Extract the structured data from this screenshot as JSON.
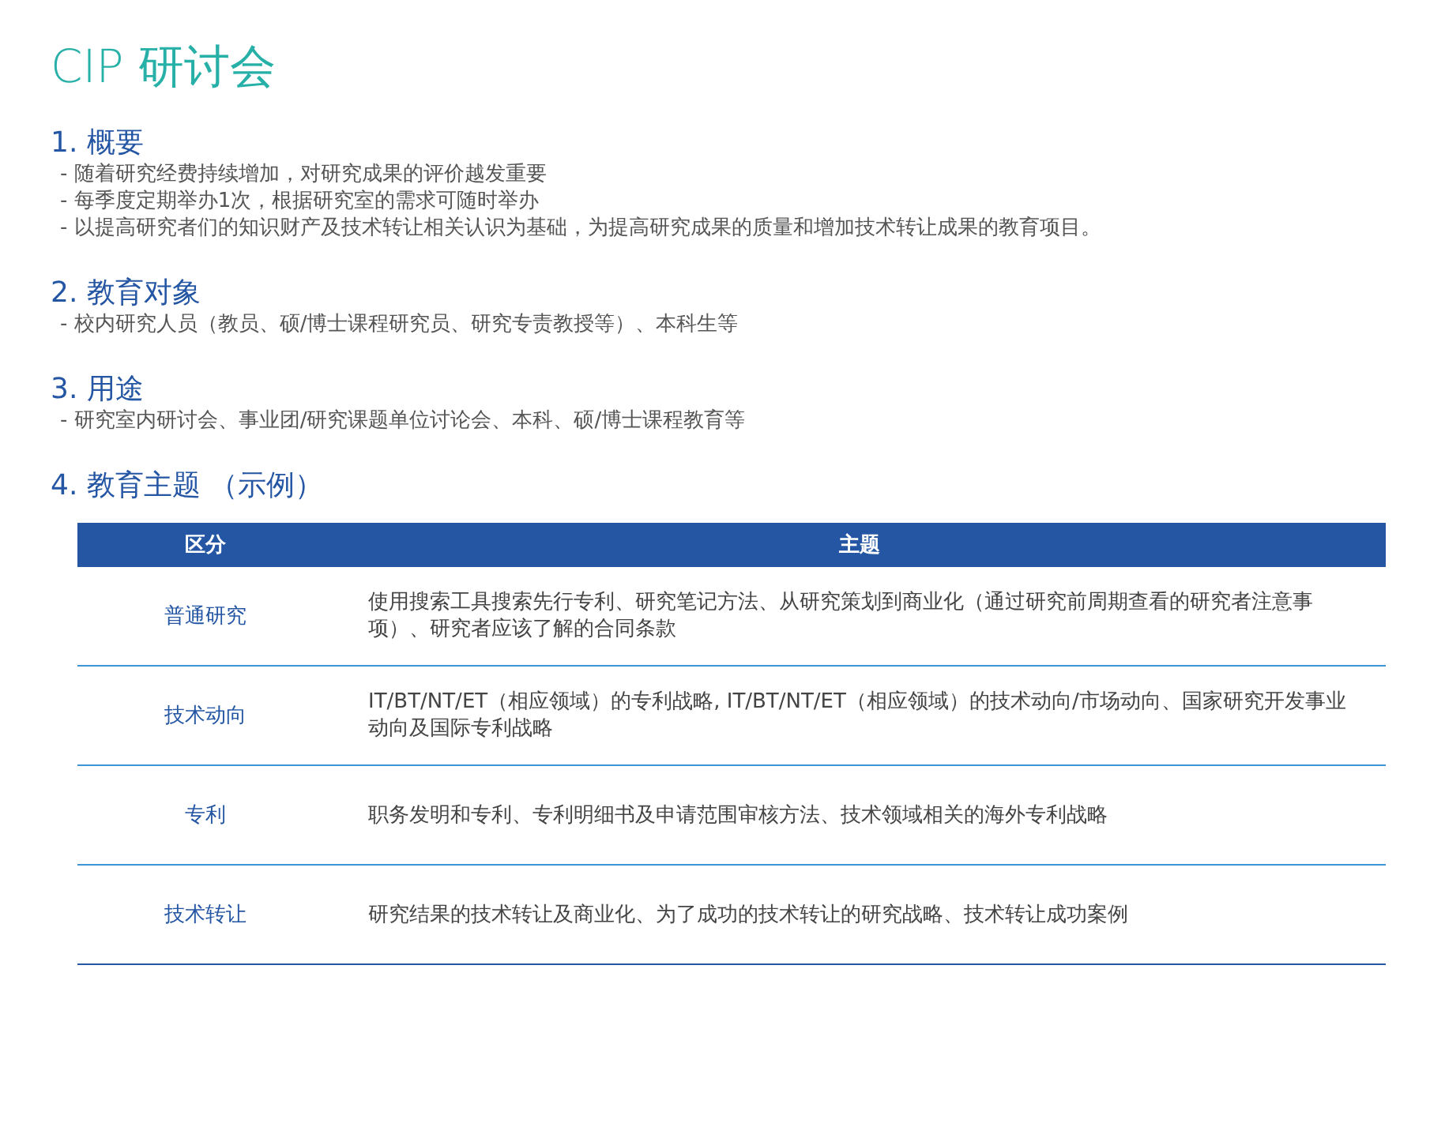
{
  "title": "CIP 研讨会",
  "sections": [
    {
      "heading": "1. 概要",
      "lines": [
        "- 随着研究经费持续增加，对研究成果的评价越发重要",
        "- 每季度定期举办1次，根据研究室的需求可随时举办",
        "- 以提高研究者们的知识财产及技术转让相关认识为基础，为提高研究成果的质量和增加技术转让成果的教育项目。"
      ]
    },
    {
      "heading": "2. 教育对象",
      "lines": [
        "- 校内研究人员（教员、硕/博士课程研究员、研究专责教授等）、本科生等"
      ]
    },
    {
      "heading": "3. 用途",
      "lines": [
        "- 研究室内研讨会、事业团/研究课题单位讨论会、本科、硕/博士课程教育等"
      ]
    },
    {
      "heading": "4. 教育主题 （示例）"
    }
  ],
  "table": {
    "columns": [
      "区分",
      "主题"
    ],
    "rows": [
      {
        "category": "普通研究",
        "topic": "使用搜索工具搜索先行专利、研究笔记方法、从研究策划到商业化（通过研究前周期查看的研究者注意事项）、研究者应该了解的合同条款"
      },
      {
        "category": "技术动向",
        "topic": "IT/BT/NT/ET（相应领域）的专利战略, IT/BT/NT/ET（相应领域）的技术动向/市场动向、国家研究开发事业动向及国际专利战略"
      },
      {
        "category": "专利",
        "topic": "职务发明和专利、专利明细书及申请范围审核方法、技术领域相关的海外专利战略"
      },
      {
        "category": "技术转让",
        "topic": "研究结果的技术转让及商业化、为了成功的技术转让的研究战略、技术转让成功案例"
      }
    ]
  }
}
